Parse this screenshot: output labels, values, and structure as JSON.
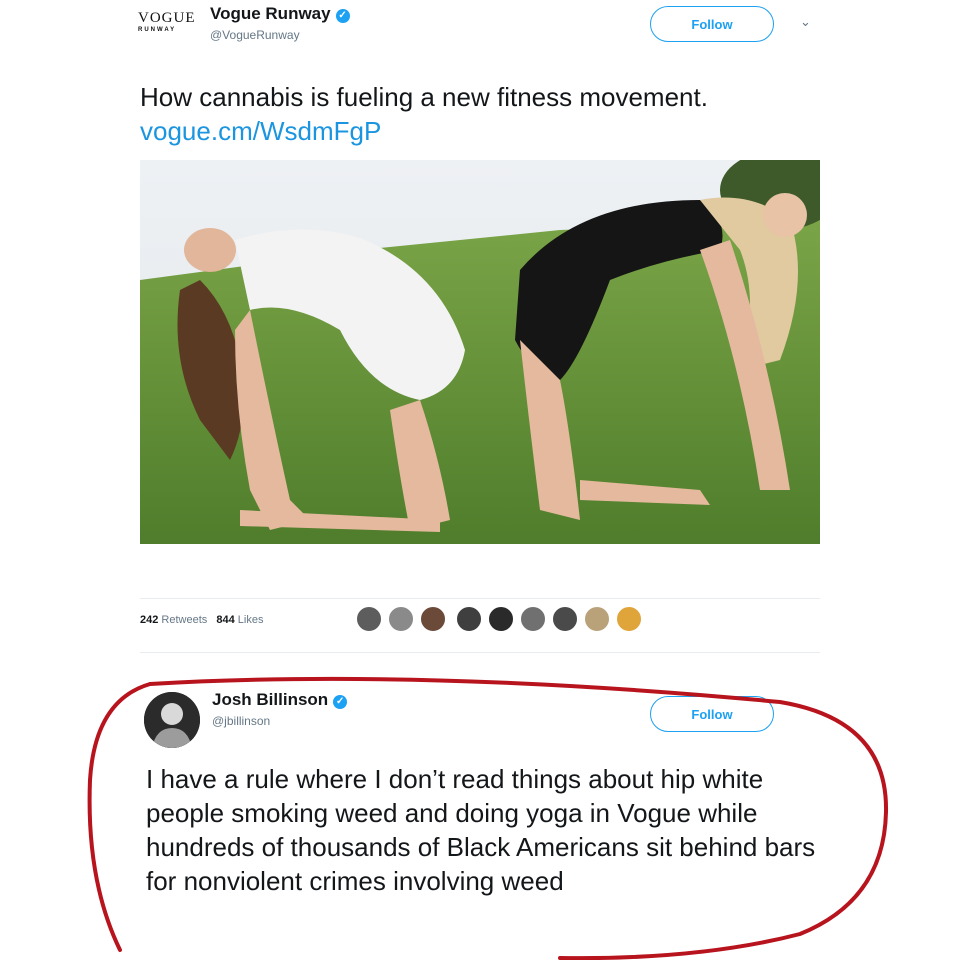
{
  "tweet1": {
    "logo_line1": "VOGUE",
    "logo_line2": "RUNWAY",
    "display_name": "Vogue Runway",
    "handle": "@VogueRunway",
    "follow_label": "Follow",
    "text": "How cannabis is fueling a new fitness movement.",
    "link": "vogue.cm/WsdmFgP",
    "retweets_count": "242",
    "retweets_label": "Retweets",
    "likes_count": "844",
    "likes_label": "Likes"
  },
  "tweet2": {
    "display_name": "Josh Billinson",
    "handle": "@jbillinson",
    "follow_label": "Follow",
    "text": "I have a rule where I don’t read things about hip white people smoking weed and doing yoga in Vogue while hundreds of thousands of Black Americans sit behind bars for nonviolent crimes involving weed"
  },
  "icons": {
    "verified": "verified-check-icon",
    "chevron": "chevron-down-icon"
  },
  "colors": {
    "accent": "#1da1f2",
    "link": "#1b95e0",
    "annotation": "#b8141e",
    "muted": "#657786"
  }
}
